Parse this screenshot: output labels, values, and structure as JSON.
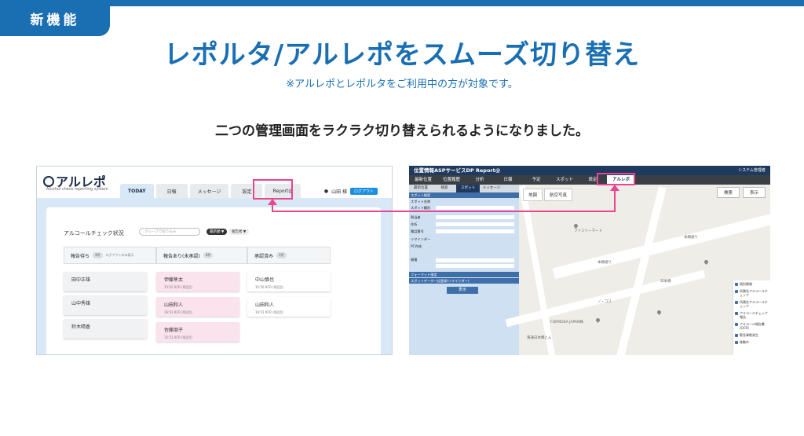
{
  "badge": "新機能",
  "headline": "レポルタ/アルレポをスムーズ切り替え",
  "note": "※アルレポとレポルタをご利用中の方が対象です。",
  "subline": "二つの管理画面をラクラク切り替えられるようになりました。",
  "colors": {
    "brand": "#1a6fb3",
    "highlight": "#e84690"
  },
  "left_screen": {
    "logo": "アルレポ",
    "logo_sub": "Alcohol check reporting system",
    "tabs": [
      "TODAY",
      "日報",
      "メッセージ",
      "設定",
      "Report@"
    ],
    "user": "山田 様",
    "logout": "ログアウト",
    "section_title": "アルコールチェック状況",
    "select_placeholder": "グループで絞り込み",
    "chip1": "最新順 ▼",
    "chip2": "報告者 ▼",
    "columns": [
      {
        "label": "報告待ち",
        "count": "3件",
        "extra": "ログアウトのみ表示"
      },
      {
        "label": "報告あり(未承認)",
        "count": "3件"
      },
      {
        "label": "承認済み",
        "count": "1件"
      }
    ],
    "cards_waiting": [
      "田中正雄",
      "山中秀雄",
      "鈴木晴香"
    ],
    "cards_pending": [
      {
        "name": "伊藤隼太",
        "sub": "15:52 0CR (0回目)"
      },
      {
        "name": "山田和人",
        "sub": "16:51 0CR (0回目)"
      },
      {
        "name": "佐藤朋子",
        "sub": "15:51 0CR (0回目)"
      }
    ],
    "cards_approved": [
      {
        "name": "中山慎也",
        "sub": "15:50 0CR (0回目)"
      },
      {
        "name": "山田和人",
        "sub": "16:51 0CR (0回目)"
      }
    ]
  },
  "right_screen": {
    "title": "位置情報ASPサービスDP Report@",
    "admin": "システム管理者",
    "menu": [
      "最新位置",
      "位置履歴",
      "分析",
      "日報",
      "予定",
      "スポット",
      "設定",
      "アルレポ"
    ],
    "subtabs": [
      "最新位置",
      "検索",
      "スポット",
      "メッセージ"
    ],
    "side_rows": [
      "スポット検索",
      "スポット名称",
      "スポット種別",
      "",
      "割当者",
      "住所",
      "電話番号",
      "リマインダー",
      "PC作成",
      "",
      "順番",
      "",
      "",
      "フォーマット指定",
      "スポットデータ一括登録(リマインダー)"
    ],
    "show_btn": "表示",
    "map_tabs": [
      "地図",
      "航空写真"
    ],
    "buttons": [
      "検索",
      "表示"
    ],
    "map_labels": [
      "本願通り",
      "本願通り",
      "ファミリーマート",
      "FORMOSA JAPAN株",
      "日本橋",
      "ノ・コス",
      "東通日本橋とん"
    ],
    "legend": [
      "個別情報",
      "所属先アルコールチェック",
      "所属先アルコールチェック",
      "アルコールチェック報告",
      "アルコール報告書(OCR)",
      "緊急事態発生",
      "移動中"
    ]
  }
}
